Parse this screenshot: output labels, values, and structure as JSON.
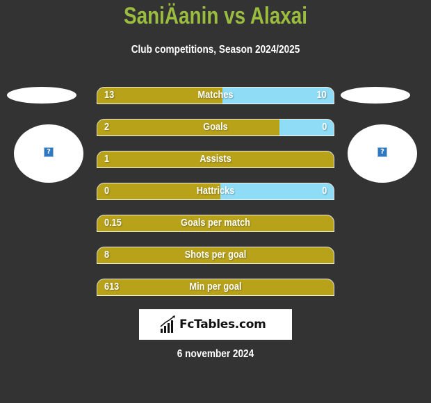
{
  "header": {
    "title": "SaniÄanin vs Alaxai",
    "subtitle": "Club competitions, Season 2024/2025"
  },
  "teams": {
    "left": {
      "logo_icon": "broken-image-icon",
      "logo_glyph": "?"
    },
    "right": {
      "logo_icon": "broken-image-icon",
      "logo_glyph": "?"
    }
  },
  "colors": {
    "background": "#333333",
    "title": "#9bbd3f",
    "left_bar": "#b8a21a",
    "right_bar": "#8fdcf6"
  },
  "stats": [
    {
      "label": "Matches",
      "left": "13",
      "right": "10",
      "left_fraction": 0.53
    },
    {
      "label": "Goals",
      "left": "2",
      "right": "0",
      "left_fraction": 0.77
    },
    {
      "label": "Assists",
      "left": "1",
      "right": "",
      "left_fraction": 1.0
    },
    {
      "label": "Hattricks",
      "left": "0",
      "right": "0",
      "left_fraction": 0.52
    },
    {
      "label": "Goals per match",
      "left": "0.15",
      "right": "",
      "left_fraction": 1.0
    },
    {
      "label": "Shots per goal",
      "left": "8",
      "right": "",
      "left_fraction": 1.0
    },
    {
      "label": "Min per goal",
      "left": "613",
      "right": "",
      "left_fraction": 1.0
    }
  ],
  "brand": {
    "text": "FcTables.com",
    "icon": "bar-chart-trend-icon"
  },
  "footer": {
    "date": "6 november 2024"
  }
}
